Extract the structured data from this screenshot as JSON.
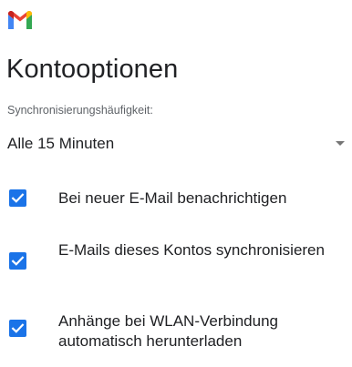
{
  "app": {
    "logo_icon": "gmail-logo-icon",
    "title": "Kontooptionen"
  },
  "sync": {
    "label": "Synchronisierungshäufigkeit:",
    "value": "Alle 15 Minuten"
  },
  "options": [
    {
      "label": "Bei neuer E-Mail benachrichtigen",
      "checked": true
    },
    {
      "label": "E-Mails dieses Kontos synchronisieren",
      "checked": true
    },
    {
      "label": "Anhänge bei WLAN-Verbindung automatisch herunterladen",
      "checked": true
    }
  ],
  "colors": {
    "accent": "#1a73e8",
    "text": "#202124",
    "secondary_text": "#5f6368"
  }
}
